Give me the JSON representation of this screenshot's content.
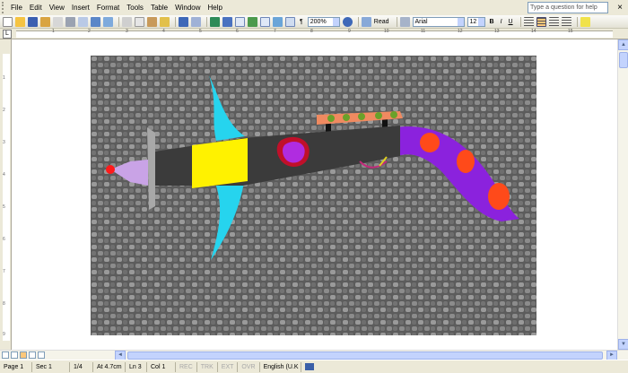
{
  "menubar": {
    "items": [
      {
        "name": "menu-file",
        "label": "File"
      },
      {
        "name": "menu-edit",
        "label": "Edit"
      },
      {
        "name": "menu-view",
        "label": "View"
      },
      {
        "name": "menu-insert",
        "label": "Insert"
      },
      {
        "name": "menu-format",
        "label": "Format"
      },
      {
        "name": "menu-tools",
        "label": "Tools"
      },
      {
        "name": "menu-table",
        "label": "Table"
      },
      {
        "name": "menu-window",
        "label": "Window"
      },
      {
        "name": "menu-help",
        "label": "Help"
      }
    ],
    "help_placeholder": "Type a question for help",
    "close_glyph": "×"
  },
  "toolbar": {
    "zoom": "200%",
    "read_label": "Read",
    "font": "Arial",
    "font_size": "12",
    "bold": "B",
    "italic": "I",
    "underline": "U",
    "show_formatting_glyph": "¶"
  },
  "ruler": {
    "tab_selector": "L",
    "numbers": [
      "1",
      "2",
      "3",
      "4",
      "5",
      "6",
      "7",
      "8",
      "9",
      "10",
      "11",
      "12",
      "13",
      "14",
      "15"
    ],
    "vertical_numbers": [
      "1",
      "2",
      "3",
      "4",
      "5",
      "6",
      "7",
      "8",
      "9"
    ]
  },
  "scroll": {
    "up": "▲",
    "down": "▼",
    "left": "◄",
    "right": "►"
  },
  "status": {
    "page": "Page 1",
    "sec": "Sec 1",
    "pages": "1/4",
    "at": "At 4.7cm",
    "ln": "Ln 3",
    "col": "Col 1",
    "rec": "REC",
    "trk": "TRK",
    "ext": "EXT",
    "ovr": "OVR",
    "language": "English (U.K"
  },
  "colors": {
    "accent_highlight": "#fcc77a",
    "xp_blue": "#c3d3fd",
    "chrome": "#ece9d8"
  },
  "icons": {
    "toolbar": [
      "new-document-icon",
      "open-folder-icon",
      "save-icon",
      "permission-icon",
      "email-icon",
      "print-icon",
      "print-preview-icon",
      "spelling-icon",
      "research-icon",
      "cut-icon",
      "copy-icon",
      "paste-icon",
      "format-painter-icon",
      "undo-icon",
      "redo-icon",
      "hyperlink-icon",
      "tables-borders-icon",
      "insert-table-icon",
      "insert-excel-icon",
      "columns-icon",
      "drawing-icon",
      "document-map-icon",
      "show-formatting-icon",
      "help-icon",
      "read-icon",
      "styles-icon",
      "bold-icon",
      "italic-icon",
      "underline-icon",
      "align-left-icon",
      "center-icon",
      "align-right-icon",
      "justify-icon",
      "highlight-icon"
    ]
  }
}
